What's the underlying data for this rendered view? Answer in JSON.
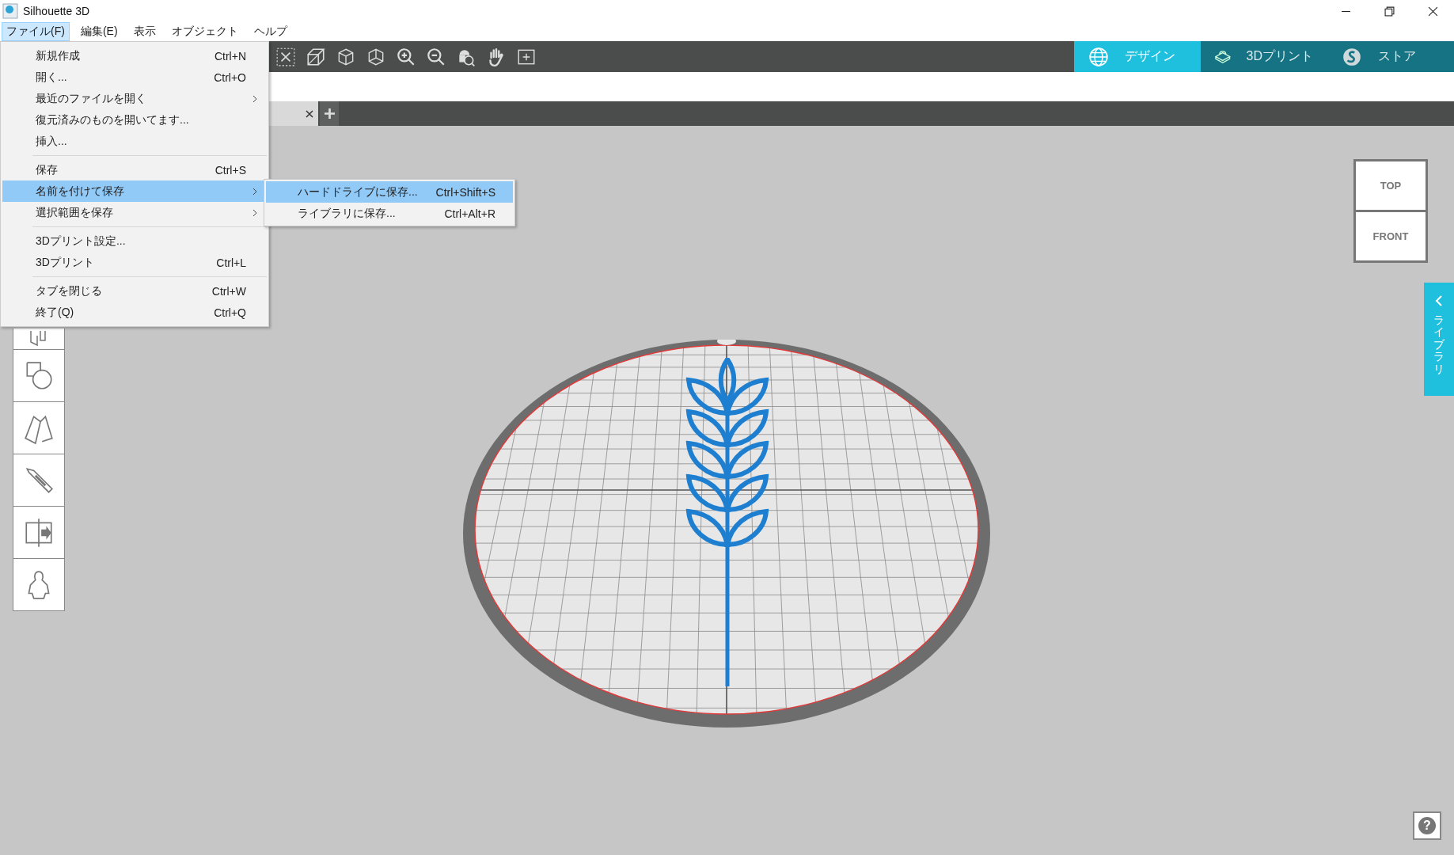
{
  "window": {
    "title": "Silhouette 3D"
  },
  "menubar": [
    {
      "label": "ファイル(F)",
      "selected": true
    },
    {
      "label": "編集(E)",
      "selected": false
    },
    {
      "label": "表示",
      "selected": false
    },
    {
      "label": "オブジェクト",
      "selected": false
    },
    {
      "label": "ヘルプ",
      "selected": false
    }
  ],
  "file_menu": [
    [
      {
        "label": "新規作成",
        "shortcut": "Ctrl+N",
        "submenu": false,
        "selected": false
      },
      {
        "label": "開く...",
        "shortcut": "Ctrl+O",
        "submenu": false,
        "selected": false
      },
      {
        "label": "最近のファイルを開く",
        "submenu": true,
        "selected": false
      },
      {
        "label": "復元済みのものを開いてます...",
        "submenu": false,
        "selected": false
      },
      {
        "label": "挿入...",
        "submenu": false,
        "selected": false
      }
    ],
    [
      {
        "label": "保存",
        "shortcut": "Ctrl+S",
        "submenu": false,
        "selected": false
      },
      {
        "label": "名前を付けて保存",
        "submenu": true,
        "selected": true
      },
      {
        "label": "選択範囲を保存",
        "submenu": true,
        "selected": false
      }
    ],
    [
      {
        "label": "3Dプリント設定...",
        "submenu": false,
        "selected": false
      },
      {
        "label": "3Dプリント",
        "shortcut": "Ctrl+L",
        "submenu": false,
        "selected": false
      }
    ],
    [
      {
        "label": "タブを閉じる",
        "shortcut": "Ctrl+W",
        "submenu": false,
        "selected": false
      },
      {
        "label": "終了(Q)",
        "shortcut": "Ctrl+Q",
        "submenu": false,
        "selected": false
      }
    ]
  ],
  "save_as_submenu": [
    {
      "label": "ハードドライブに保存...",
      "shortcut": "Ctrl+Shift+S",
      "selected": true
    },
    {
      "label": "ライブラリに保存...",
      "shortcut": "Ctrl+Alt+R",
      "selected": false
    }
  ],
  "mode_tabs": [
    {
      "label": "デザイン",
      "kind": "globe",
      "selected": true
    },
    {
      "label": "3Dプリント",
      "kind": "print",
      "selected": false
    },
    {
      "label": "ストア",
      "kind": "store",
      "selected": false
    }
  ],
  "view_cube": {
    "top": "TOP",
    "front": "FRONT"
  },
  "library_panel": {
    "label": "ライブラリ"
  },
  "help_button": {
    "label": "?"
  }
}
